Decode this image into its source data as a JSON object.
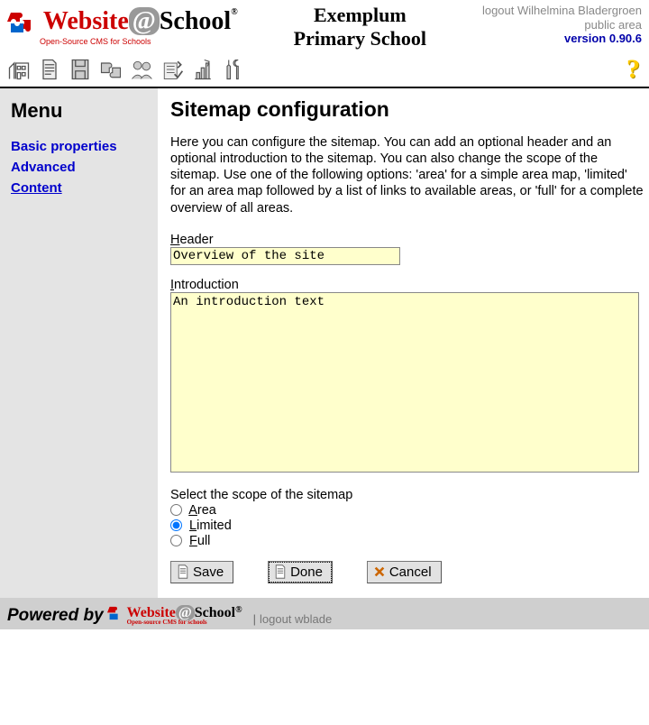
{
  "header": {
    "logo": {
      "part1": "Website",
      "part2": "@",
      "part3": "School",
      "sub": "Open-Source CMS for Schools"
    },
    "title1": "Exemplum",
    "title2": "Primary School",
    "right": {
      "logout_line": "logout Wilhelmina Bladergroen",
      "area_line": "public area",
      "version": "version 0.90.6"
    }
  },
  "toolbar_icons": [
    "home-icon",
    "page-icon",
    "save-icon",
    "modules-icon",
    "accounts-icon",
    "config-icon",
    "stats-icon",
    "tools-icon"
  ],
  "sidebar": {
    "heading": "Menu",
    "items": [
      {
        "label": "Basic properties",
        "current": false
      },
      {
        "label": "Advanced",
        "current": false
      },
      {
        "label": "Content",
        "current": true
      }
    ]
  },
  "content": {
    "title": "Sitemap configuration",
    "intro": "Here you can configure the sitemap. You can add an optional header and an optional introduction to the sitemap. You can also change the scope of the sitemap. Use one of the following options: 'area' for a simple area map, 'limited' for an area map followed by a list of links to available areas, or 'full' for a complete overview of all areas.",
    "header_field": {
      "label_pre": "H",
      "label_rest": "eader",
      "value": "Overview of the site"
    },
    "intro_field": {
      "label_pre": "I",
      "label_rest": "ntroduction",
      "value": "An introduction text"
    },
    "scope": {
      "legend": "Select the scope of the sitemap",
      "options": [
        {
          "ak": "A",
          "rest": "rea",
          "value": "area",
          "checked": false
        },
        {
          "ak": "L",
          "rest": "imited",
          "value": "limited",
          "checked": true
        },
        {
          "ak": "F",
          "rest": "ull",
          "value": "full",
          "checked": false
        }
      ]
    },
    "buttons": {
      "save": "Save",
      "done": "Done",
      "cancel": "Cancel"
    }
  },
  "footer": {
    "powered": "Powered by",
    "logo": {
      "part1": "Website",
      "part2": "@",
      "part3": "School",
      "sub": "Open-source CMS for schools"
    },
    "sep": "|",
    "logout": "logout wblade"
  }
}
